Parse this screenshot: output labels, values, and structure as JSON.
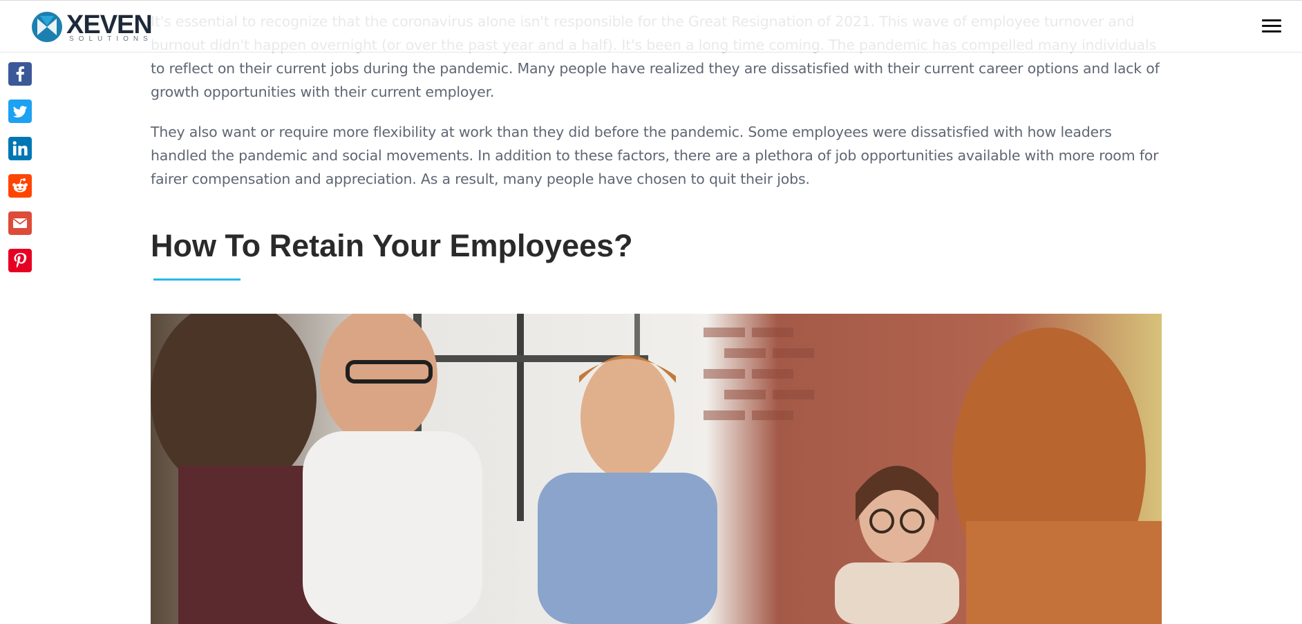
{
  "header": {
    "logo_word": "XEVEN",
    "logo_sub": "SOLUTIONS"
  },
  "share": [
    {
      "name": "facebook",
      "color": "#3b5998"
    },
    {
      "name": "twitter",
      "color": "#1da1f2"
    },
    {
      "name": "linkedin",
      "color": "#0077b5"
    },
    {
      "name": "reddit",
      "color": "#ff4500"
    },
    {
      "name": "email",
      "color": "#dd4b39"
    },
    {
      "name": "pinterest",
      "color": "#e60023"
    }
  ],
  "article": {
    "para1": "It's essential to recognize that the coronavirus alone isn't responsible for the Great Resignation of 2021. This wave of employee turnover and burnout didn't happen overnight (or over the past year and a half). It's been a long time coming. The pandemic has compelled many individuals to reflect on their current jobs during the pandemic. Many people have realized they are dissatisfied with their current career options and lack of growth opportunities with their current employer.",
    "para2": "They also want or require more flexibility at work than they did before the pandemic. Some employees were dissatisfied with how leaders handled the pandemic and social movements. In addition to these factors, there are a plethora of job opportunities available with more room for fairer compensation and appreciation. As a result, many people have chosen to quit their jobs.",
    "heading": "How To Retain Your Employees?"
  },
  "colors": {
    "accent": "#29b6e8",
    "heading": "#2a2a2a",
    "body_text": "#5f6673"
  }
}
